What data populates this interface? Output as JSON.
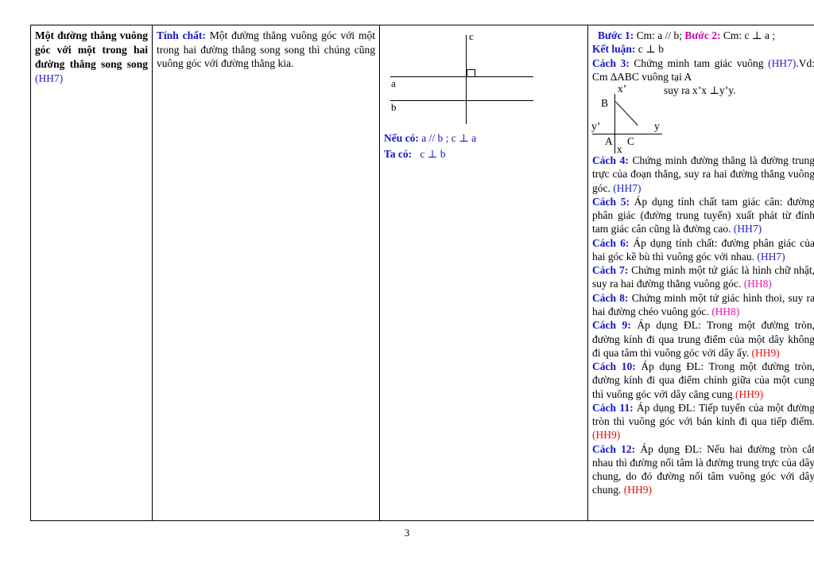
{
  "page": {
    "number": "3"
  },
  "table": {
    "row": {
      "col1": {
        "title": "Một đường thẳng vuông góc với một trong hai đường thẳng song song",
        "code": "(HH7)"
      },
      "col2": {
        "label": "Tính chất:",
        "text": " Một đường thẳng vuông góc với một trong hai đường thẳng song song thì chúng cũng vuông góc với đường thẳng kia."
      },
      "col3": {
        "diagram": {
          "label_c": "c",
          "label_a": "a",
          "label_b": "b",
          "right_angle_mark": "right-angle-square"
        },
        "given_label": "Nếu có:",
        "given_value": "a // b ; c ⊥ a",
        "result_label": "Ta có:",
        "result_value": "c ⊥ b"
      },
      "col4": {
        "step1_label": "Bước 1:",
        "step1_text": " Cm:  a // b;",
        "step2_label": "Bước 2:",
        "step2_text": "  Cm: c ⊥ a ;",
        "conclusion_label": "Kết luận:",
        "conclusion_text": " c ⊥ b",
        "methods": [
          {
            "label": "Cách 3:",
            "label_color": "blue",
            "text_before": " Chứng minh tam giác vuông ",
            "code": "(HH7)",
            "code_color": "blue",
            "text_after": ".Vd: Cm  ∆ABC vuông tại A"
          },
          {
            "label": "Cách 4:",
            "label_color": "blue",
            "text_before": " Chứng minh đường thẳng là đường trung trực của đoạn thẳng, suy ra hai đường thẳng vuông góc. ",
            "code": "(HH7)",
            "code_color": "blue",
            "text_after": ""
          },
          {
            "label": "Cách 5:",
            "label_color": "blue",
            "text_before": " Áp dụng tính chất tam giác cân: đường phân giác (đường trung tuyến) xuất phát từ đỉnh tam giác cân cũng là đường cao. ",
            "code": "(HH7)",
            "code_color": "blue",
            "text_after": ""
          },
          {
            "label": "Cách 6:",
            "label_color": "blue",
            "text_before": " Áp dụng tính chất: đường phân giác của hai góc kề bù thì vuông góc với nhau. ",
            "code": "(HH7)",
            "code_color": "blue",
            "text_after": ""
          },
          {
            "label": "Cách 7:",
            "label_color": "blue",
            "text_before": " Chứng minh một tứ giác là hình chữ nhật, suy ra hai đường thẳng vuông góc. ",
            "code": "(HH8)",
            "code_color": "magenta",
            "text_after": ""
          },
          {
            "label": "Cách 8:",
            "label_color": "blue",
            "text_before": " Chứng minh một tứ giác hình thoi, suy ra hai đường chéo vuông góc.  ",
            "code": "(HH8)",
            "code_color": "magenta",
            "text_after": ""
          },
          {
            "label": "Cách 9:",
            "label_color": "blue",
            "text_before": " Áp dụng ĐL: Trong một đường tròn, đường kính đi qua trung điểm của một dây không đi qua tâm thì vuông góc với dây ấy. ",
            "code": "(HH9)",
            "code_color": "red",
            "text_after": ""
          },
          {
            "label": "Cách 10:",
            "label_color": "blue",
            "text_before": " Áp dụng ĐL: Trong một đường tròn, đường kính đi qua điểm chính giữa của một cung thì vuông góc với dây căng cung  ",
            "code": "(HH9)",
            "code_color": "red",
            "text_after": ""
          },
          {
            "label": "Cách 11:",
            "label_color": "blue",
            "text_before": " Áp dụng ĐL: Tiếp tuyến của một đường tròn thì vuông góc với bán kính đi qua tiếp điểm. ",
            "code": "(HH9)",
            "code_color": "red",
            "text_after": ""
          },
          {
            "label": "Cách 12:",
            "label_color": "blue",
            "text_before": " Áp dụng ĐL: Nếu hai đường tròn cắt nhau thì đường nối tâm là đường trung trực của dây chung, do đó đường nối tâm vuông góc với dây chung. ",
            "code": "(HH9)",
            "code_color": "red",
            "text_after": ""
          }
        ],
        "triangle_diagram": {
          "label_xprime": "x’",
          "label_B": "B",
          "label_yprime": "y’",
          "label_y": "y",
          "label_A": "A",
          "label_C": "C",
          "label_x": "x",
          "note": "suy ra  x’x  ⊥y’y."
        }
      }
    }
  },
  "colors": {
    "heading_blue": "#1414c8",
    "code_blue": "#2222cc",
    "code_magenta": "#e01ab0",
    "code_red": "#e01010",
    "rule_black": "#000000"
  }
}
